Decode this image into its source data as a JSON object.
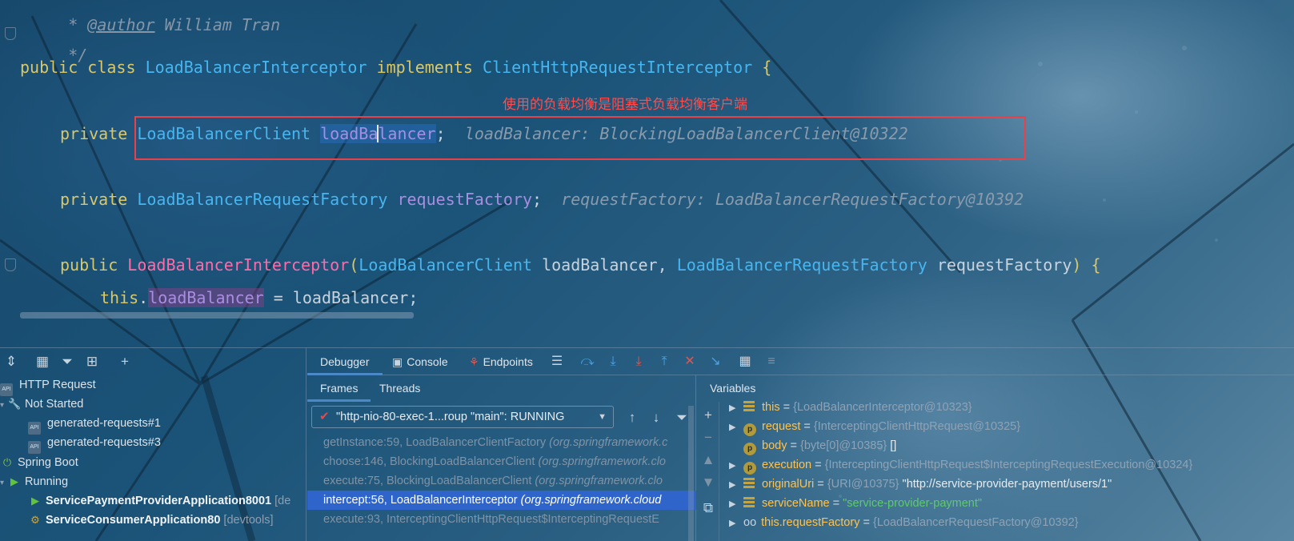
{
  "code": {
    "author_line_prefix": " * ",
    "author_tag": "@author",
    "author_name": " William Tran",
    "comment_end": " */",
    "line_class": {
      "kw1": "public",
      "kw2": "class",
      "name": "LoadBalancerInterceptor",
      "kw3": "implements",
      "iface": "ClientHttpRequestInterceptor",
      "brace": "{"
    },
    "line_field1": {
      "kw": "private",
      "type": "LoadBalancerClient",
      "name_a": "loadBa",
      "name_b": "lancer",
      "semi": ";",
      "hint": "loadBalancer: BlockingLoadBalancerClient@10322"
    },
    "line_field2": {
      "kw": "private",
      "type": "LoadBalancerRequestFactory",
      "name": "requestFactory",
      "semi": ";",
      "hint": "requestFactory: LoadBalancerRequestFactory@10392"
    },
    "line_ctor": {
      "kw": "public",
      "name": "LoadBalancerInterceptor",
      "open": "(",
      "p1_type": "LoadBalancerClient",
      "p1_name": "loadBalancer",
      "comma": ", ",
      "p2_type": "LoadBalancerRequestFactory",
      "p2_name": "requestFactory",
      "close": ") {"
    },
    "line_assign": {
      "this": "this",
      "dot": ".",
      "field": "loadBalancer",
      "rest": " = loadBalancer;"
    },
    "annotation": "使用的负载均衡是阻塞式负载均衡客户端"
  },
  "services": {
    "tree": [
      {
        "label": "HTTP Request",
        "icon": "api-icon"
      },
      {
        "label": "Not Started",
        "icon": "wrench-icon"
      },
      {
        "label": "generated-requests#1",
        "icon": "api-icon"
      },
      {
        "label": "generated-requests#3",
        "icon": "api-icon"
      },
      {
        "label": "Spring Boot",
        "icon": "spring-icon"
      },
      {
        "label": "Running",
        "icon": "run-icon"
      },
      {
        "label": "ServicePaymentProviderApplication8001",
        "suffix": "[de",
        "icon": "run-icon"
      },
      {
        "label": "ServiceConsumerApplication80",
        "suffix": "[devtools]",
        "icon": "spring-app-icon"
      }
    ]
  },
  "debugger": {
    "tabs": [
      "Debugger",
      "Console",
      "Endpoints"
    ],
    "subtabs": [
      "Frames",
      "Threads"
    ],
    "thread": "\"http-nio-80-exec-1...roup \"main\": RUNNING",
    "frames": [
      {
        "method": "getInstance:59, LoadBalancerClientFactory",
        "pkg": "(org.springframework.c"
      },
      {
        "method": "choose:146, BlockingLoadBalancerClient",
        "pkg": "(org.springframework.clo"
      },
      {
        "method": "execute:75, BlockingLoadBalancerClient",
        "pkg": "(org.springframework.clo"
      },
      {
        "method": "intercept:56, LoadBalancerInterceptor",
        "pkg": "(org.springframework.cloud"
      },
      {
        "method": "execute:93, InterceptingClientHttpRequest$InterceptingRequestE",
        "pkg": ""
      }
    ],
    "selected_frame": 3
  },
  "variables": {
    "title": "Variables",
    "rows": [
      {
        "name": "this",
        "type": "{LoadBalancerInterceptor@10323}",
        "value": "",
        "icon": "field"
      },
      {
        "name": "request",
        "type": "{InterceptingClientHttpRequest@10325}",
        "value": "",
        "icon": "param"
      },
      {
        "name": "body",
        "type": "{byte[0]@10385}",
        "value": " []",
        "icon": "param"
      },
      {
        "name": "execution",
        "type": "{InterceptingClientHttpRequest$InterceptingRequestExecution@10324}",
        "value": "",
        "icon": "param"
      },
      {
        "name": "originalUri",
        "type": "{URI@10375}",
        "value": " \"http://service-provider-payment/users/1\"",
        "icon": "field"
      },
      {
        "name": "serviceName",
        "type": "",
        "value": "\"service-provider-payment\"",
        "icon": "field",
        "string": true
      },
      {
        "name": "this.requestFactory",
        "type": "{LoadBalancerRequestFactory@10392}",
        "value": "",
        "icon": "oo"
      }
    ]
  }
}
